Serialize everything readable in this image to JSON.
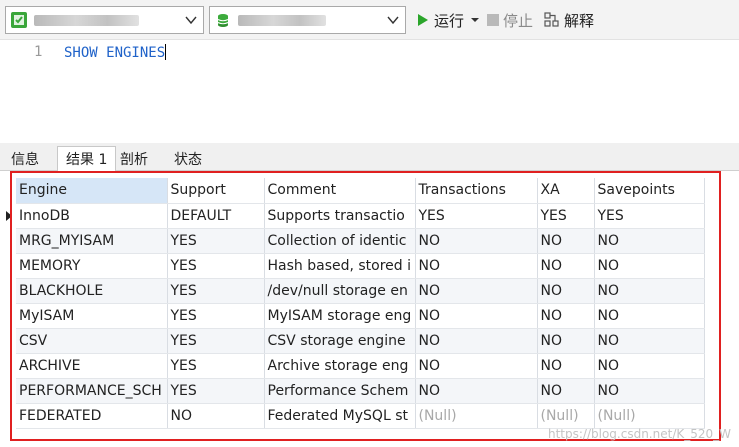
{
  "toolbar": {
    "run_label": "运行",
    "stop_label": "停止",
    "explain_label": "解释"
  },
  "editor": {
    "line_number": "1",
    "query": "SHOW ENGINES"
  },
  "tabs": [
    {
      "label": "信息"
    },
    {
      "label": "结果 1"
    },
    {
      "label": "剖析"
    },
    {
      "label": "状态"
    }
  ],
  "grid": {
    "columns": [
      "Engine",
      "Support",
      "Comment",
      "Transactions",
      "XA",
      "Savepoints"
    ],
    "rows": [
      [
        "InnoDB",
        "DEFAULT",
        "Supports transactio",
        "YES",
        "YES",
        "YES"
      ],
      [
        "MRG_MYISAM",
        "YES",
        "Collection of identic",
        "NO",
        "NO",
        "NO"
      ],
      [
        "MEMORY",
        "YES",
        "Hash based, stored i",
        "NO",
        "NO",
        "NO"
      ],
      [
        "BLACKHOLE",
        "YES",
        "/dev/null storage en",
        "NO",
        "NO",
        "NO"
      ],
      [
        "MyISAM",
        "YES",
        "MyISAM storage eng",
        "NO",
        "NO",
        "NO"
      ],
      [
        "CSV",
        "YES",
        "CSV storage engine",
        "NO",
        "NO",
        "NO"
      ],
      [
        "ARCHIVE",
        "YES",
        "Archive storage eng",
        "NO",
        "NO",
        "NO"
      ],
      [
        "PERFORMANCE_SCH",
        "YES",
        "Performance Schem",
        "NO",
        "NO",
        "NO"
      ],
      [
        "FEDERATED",
        "NO",
        "Federated MySQL st",
        "(Null)",
        "(Null)",
        "(Null)"
      ]
    ]
  },
  "watermark": "https://blog.csdn.net/K_520_W",
  "colors": {
    "highlight_border": "#e02020",
    "keyword": "#1f62c9",
    "run_icon": "#2aa52a"
  }
}
